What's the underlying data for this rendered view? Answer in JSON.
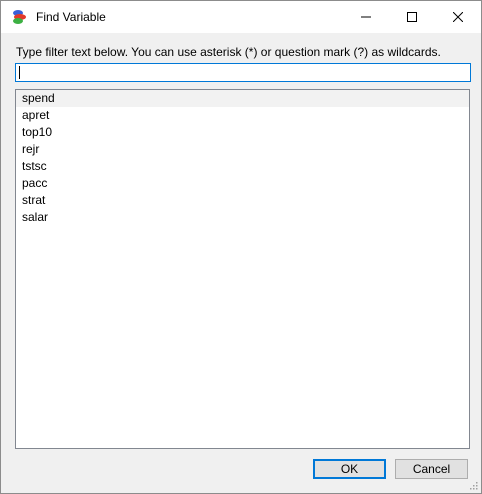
{
  "window": {
    "title": "Find Variable"
  },
  "titlebar": {
    "minimize_icon": "minimize-icon",
    "maximize_icon": "maximize-icon",
    "close_icon": "close-icon"
  },
  "filter": {
    "instruction": "Type filter text below. You can use asterisk (*) or question mark (?) as wildcards.",
    "value": ""
  },
  "variables": [
    "spend",
    "apret",
    "top10",
    "rejr",
    "tstsc",
    "pacc",
    "strat",
    "salar"
  ],
  "buttons": {
    "ok": "OK",
    "cancel": "Cancel"
  },
  "colors": {
    "accent": "#0078d7",
    "dialog_bg": "#f0f0f0",
    "hover_row": "#f2f2f2"
  }
}
